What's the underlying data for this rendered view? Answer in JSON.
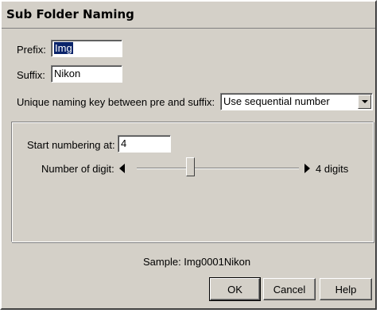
{
  "window": {
    "title": "Sub Folder Naming"
  },
  "prefix": {
    "label": "Prefix:",
    "value": "Img"
  },
  "suffix": {
    "label": "Suffix:",
    "value": "Nikon"
  },
  "naming_key": {
    "label": "Unique naming key between pre and suffix:",
    "selected": "Use sequential number"
  },
  "numbering": {
    "start_label": "Start numbering at:",
    "start_value": "4",
    "digits_label": "Number of digit:",
    "digits_value_label": "4 digits",
    "digits_fraction": 0.33
  },
  "sample": {
    "text": "Sample: Img0001Nikon"
  },
  "buttons": {
    "ok": "OK",
    "cancel": "Cancel",
    "help": "Help"
  }
}
